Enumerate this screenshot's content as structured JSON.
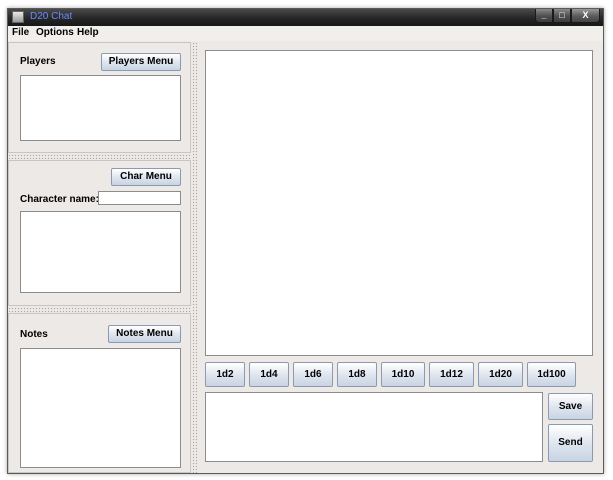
{
  "window": {
    "title": "D20 Chat",
    "min_label": "_",
    "max_label": "□",
    "close_label": "X"
  },
  "menu": {
    "file": "File",
    "options": "Options",
    "help": "Help"
  },
  "players": {
    "label": "Players",
    "menu_button": "Players Menu"
  },
  "character": {
    "menu_button": "Char Menu",
    "name_label": "Character name:",
    "name_value": ""
  },
  "notes": {
    "label": "Notes",
    "menu_button": "Notes Menu"
  },
  "dice": [
    "1d2",
    "1d4",
    "1d6",
    "1d8",
    "1d10",
    "1d12",
    "1d20",
    "1d100"
  ],
  "actions": {
    "save": "Save",
    "send": "Send"
  },
  "colors": {
    "title_text": "#6a8aff",
    "button_border": "#8a9ab0",
    "window_bg": "#ece9e6"
  }
}
